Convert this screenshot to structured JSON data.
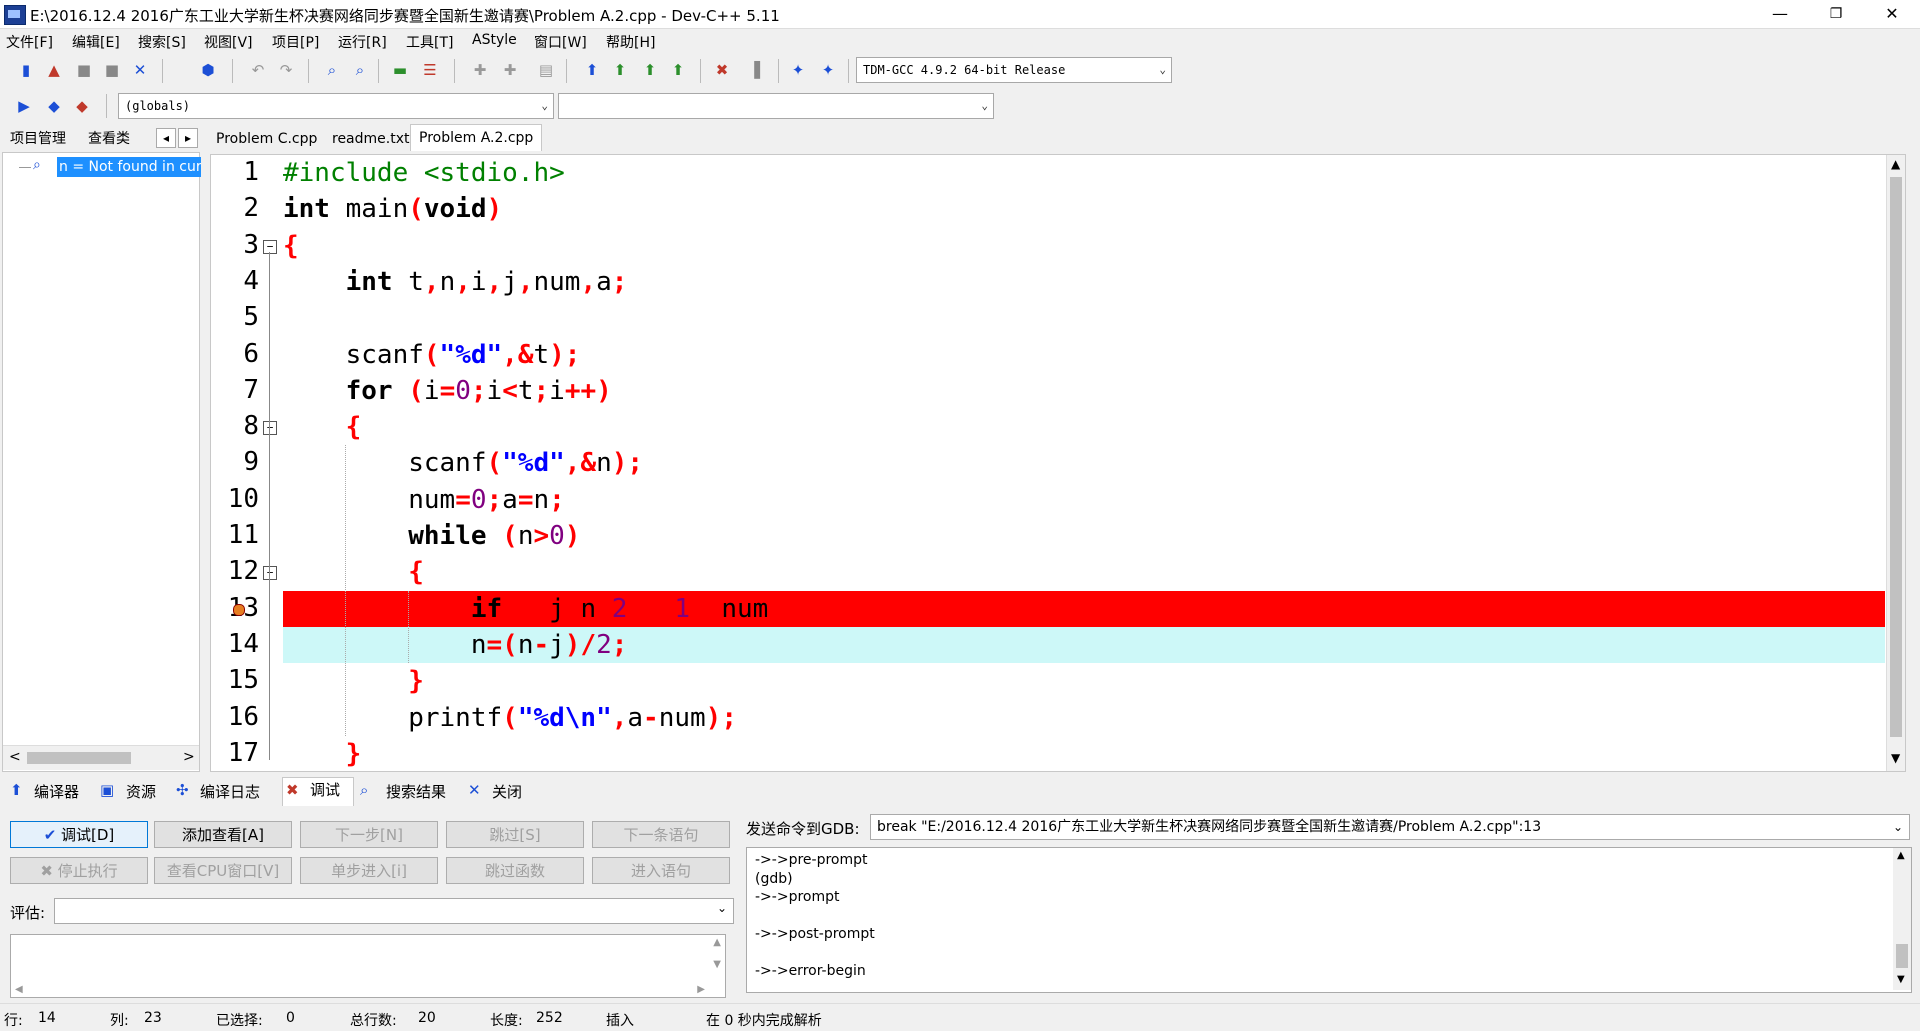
{
  "window": {
    "title": "E:\\2016.12.4 2016广东工业大学新生杯决赛网络同步赛暨全国新生邀请赛\\Problem A.2.cpp - Dev-C++ 5.11",
    "minimize": "—",
    "restore": "❐",
    "close": "✕"
  },
  "menu": [
    "文件[F]",
    "编辑[E]",
    "搜索[S]",
    "视图[V]",
    "项目[P]",
    "运行[R]",
    "工具[T]",
    "AStyle",
    "窗口[W]",
    "帮助[H]"
  ],
  "toolbar": {
    "compiler_select": "TDM-GCC 4.9.2 64-bit Release",
    "scope_select": "(globals)",
    "member_select": ""
  },
  "left_panel": {
    "tabs": [
      "项目管理",
      "查看类"
    ],
    "tab_prev": "◂",
    "tab_next": "▸",
    "watch_item": "n = Not found in cur",
    "scroll_left": "<",
    "scroll_right": ">"
  },
  "editor": {
    "tabs": [
      "Problem C.cpp",
      "readme.txt",
      "Problem A.2.cpp"
    ],
    "line_numbers": [
      "1",
      "2",
      "3",
      "4",
      "5",
      "6",
      "7",
      "8",
      "9",
      "10",
      "11",
      "12",
      "13",
      "14",
      "15",
      "16",
      "17"
    ],
    "breakpoint_line": 13,
    "current_line": 14,
    "code": [
      "#include <stdio.h>",
      "int main(void)",
      "{",
      "    int t,n,i,j,num,a;",
      "",
      "    scanf(\"%d\",&t);",
      "    for (i=0;i<t;i++)",
      "    {",
      "        scanf(\"%d\",&n);",
      "        num=0;a=n;",
      "        while (n>0)",
      "        {",
      "            if ((j=n%2)==1) num++;",
      "            n=(n-j)/2;",
      "        }",
      "        printf(\"%d\\n\",a-num);",
      "    }"
    ]
  },
  "bottom_tabs": [
    "编译器",
    "资源",
    "编译日志",
    "调试",
    "搜索结果",
    "关闭"
  ],
  "debug": {
    "buttons_row1": [
      "调试[D]",
      "添加查看[A]",
      "下一步[N]",
      "跳过[S]",
      "下一条语句"
    ],
    "buttons_row2": [
      "停止执行",
      "查看CPU窗口[V]",
      "单步进入[i]",
      "跳过函数",
      "进入语句"
    ],
    "eval_label": "评估:",
    "eval_value": "",
    "gdb_label": "发送命令到GDB:",
    "gdb_command": "break \"E:/2016.12.4 2016广东工业大学新生杯决赛网络同步赛暨全国新生邀请赛/Problem A.2.cpp\":13",
    "gdb_output": [
      "->->pre-prompt",
      "(gdb)",
      "->->prompt",
      "",
      "->->post-prompt",
      "",
      "->->error-begin"
    ]
  },
  "status": {
    "row_label": "行:",
    "row_value": "14",
    "col_label": "列:",
    "col_value": "23",
    "sel_label": "已选择:",
    "sel_value": "0",
    "lines_label": "总行数:",
    "lines_value": "20",
    "len_label": "长度:",
    "len_value": "252",
    "mode": "插入",
    "parse": "在 0 秒内完成解析"
  },
  "colors": {
    "breakpoint_line": "#ff0000",
    "current_line": "#cdf8f8",
    "selected_item": "#1e90ff",
    "keyword_symbol": "#ff0000",
    "string": "#0000ff",
    "number": "#800080",
    "preprocessor": "#008000"
  }
}
